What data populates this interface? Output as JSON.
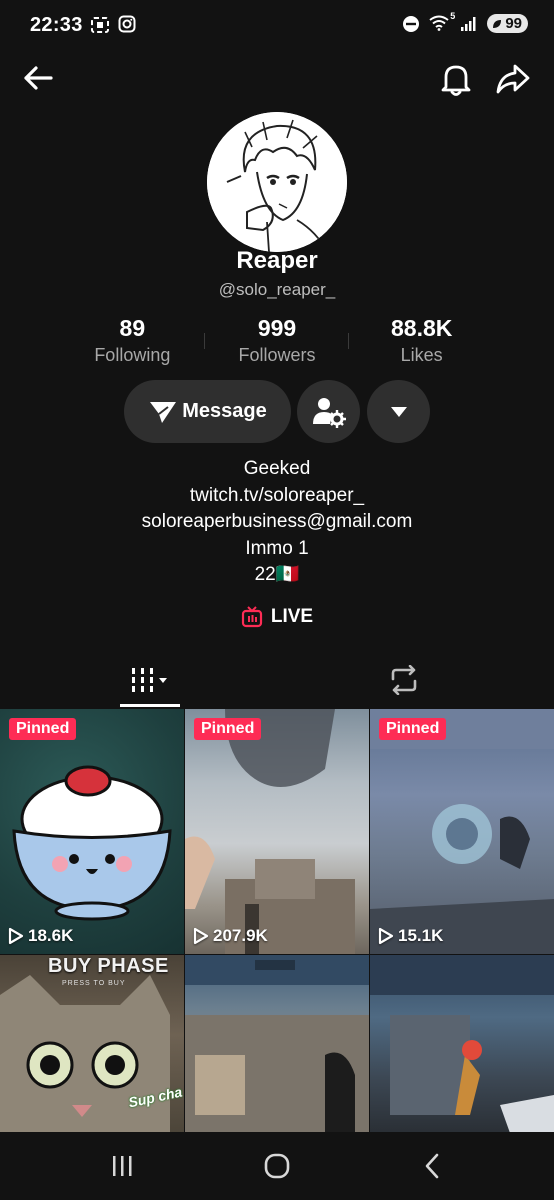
{
  "status_bar": {
    "time": "22:33",
    "battery": "99",
    "network_sup": "5"
  },
  "profile": {
    "name": "Reaper",
    "handle": "@solo_reaper_",
    "stats": [
      {
        "value": "89",
        "label": "Following"
      },
      {
        "value": "999",
        "label": "Followers"
      },
      {
        "value": "88.8K",
        "label": "Likes"
      }
    ],
    "message_label": "Message",
    "bio": [
      "Geeked",
      "twitch.tv/soloreaper_",
      "soloreaperbusiness@gmail.com",
      "Immo 1",
      "22🇲🇽"
    ],
    "live_label": "LIVE"
  },
  "videos": [
    {
      "pinned": "Pinned",
      "views": "18.6K",
      "overlay_text": ""
    },
    {
      "pinned": "Pinned",
      "views": "207.9K",
      "overlay_text": ""
    },
    {
      "pinned": "Pinned",
      "views": "15.1K",
      "overlay_text": ""
    },
    {
      "pinned": "",
      "views": "",
      "overlay_text": "BUY PHASE",
      "overlay_sub": "PRESS TO BUY",
      "caption": "Sup cha"
    },
    {
      "pinned": "",
      "views": "",
      "overlay_text": ""
    },
    {
      "pinned": "",
      "views": "",
      "overlay_text": ""
    }
  ],
  "colors": {
    "background": "#121212",
    "button": "#2f2f2f",
    "accent": "#fe2c55"
  },
  "icons": {
    "back": "arrow-left-icon",
    "bell": "bell-icon",
    "share": "share-arrow-icon",
    "message": "send-icon",
    "friend_settings": "person-gear-icon",
    "more": "caret-down-icon",
    "live": "tv-icon",
    "grid_tab": "grid-bars-icon",
    "repost_tab": "repost-icon"
  }
}
